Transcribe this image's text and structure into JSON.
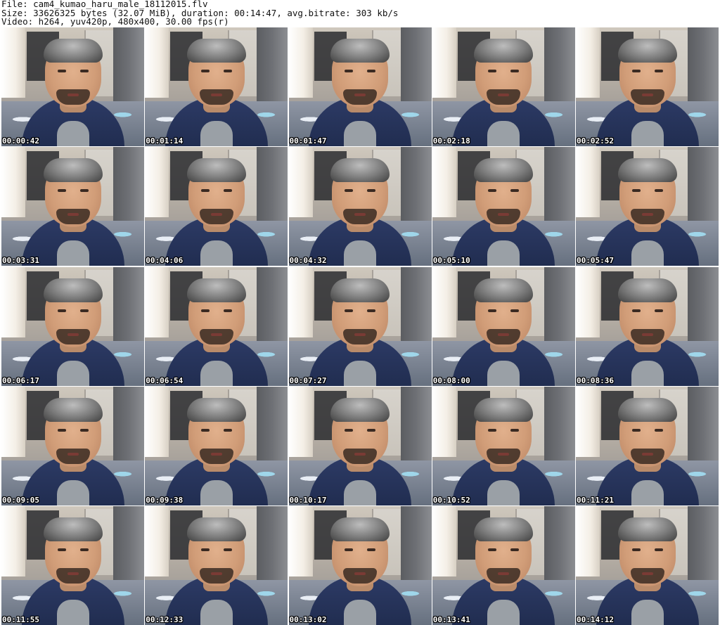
{
  "header": {
    "file_line": "File: cam4_kumao_haru_male_18112015.flv",
    "size_line": "Size: 33626325 bytes (32.07 MiB), duration: 00:14:47, avg.bitrate: 303 kb/s",
    "video_line": "Video: h264, yuv420p, 480x400, 30.00 fps(r)"
  },
  "thumbnails": [
    {
      "timestamp": "00:00:42"
    },
    {
      "timestamp": "00:01:14"
    },
    {
      "timestamp": "00:01:47"
    },
    {
      "timestamp": "00:02:18"
    },
    {
      "timestamp": "00:02:52"
    },
    {
      "timestamp": "00:03:31"
    },
    {
      "timestamp": "00:04:06"
    },
    {
      "timestamp": "00:04:32"
    },
    {
      "timestamp": "00:05:10"
    },
    {
      "timestamp": "00:05:47"
    },
    {
      "timestamp": "00:06:17"
    },
    {
      "timestamp": "00:06:54"
    },
    {
      "timestamp": "00:07:27"
    },
    {
      "timestamp": "00:08:00"
    },
    {
      "timestamp": "00:08:36"
    },
    {
      "timestamp": "00:09:05"
    },
    {
      "timestamp": "00:09:38"
    },
    {
      "timestamp": "00:10:17"
    },
    {
      "timestamp": "00:10:52"
    },
    {
      "timestamp": "00:11:21"
    },
    {
      "timestamp": "00:11:55"
    },
    {
      "timestamp": "00:12:33"
    },
    {
      "timestamp": "00:13:02"
    },
    {
      "timestamp": "00:13:41"
    },
    {
      "timestamp": "00:14:12"
    }
  ]
}
